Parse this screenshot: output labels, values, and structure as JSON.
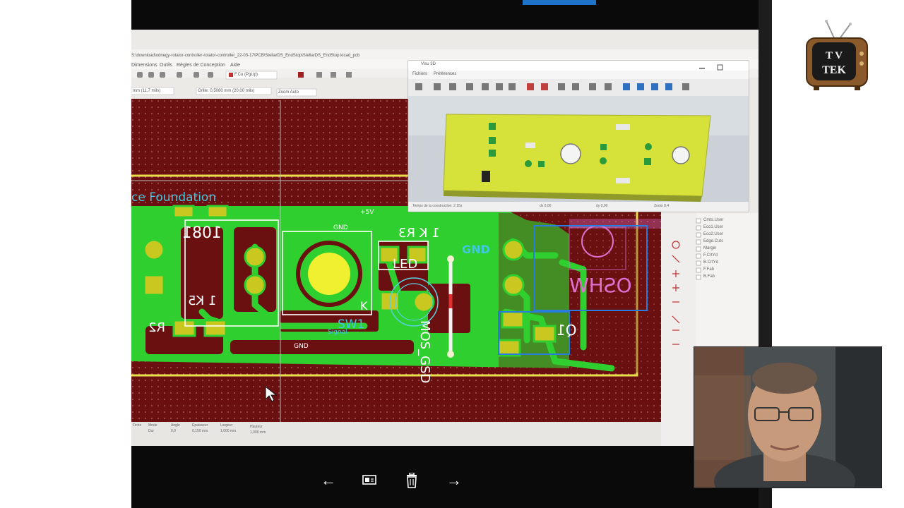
{
  "kicad": {
    "title_path": "S:\\download\\odnegy-rotator-controller-rotator-controller_22-03-17\\PCB\\StellarDS_EndStop\\StellarDS_EndStop.kicad_pcb",
    "menu": [
      "Dimensions",
      "Outils",
      "Règles de Conception",
      "Aide"
    ],
    "layer_select": "F.Cu (PgUp)",
    "track_width": "mm (11,7 mils)",
    "grid": "Grille: 0,5080 mm (20,00 mils)",
    "zoom": "Zoom Auto",
    "status": [
      "Fiche",
      "Mode",
      "Angle",
      "Épaisseur",
      "Largeur",
      "Hauteur"
    ],
    "status_values": [
      "Dur",
      "0,0",
      "0,150 mm",
      "1,000 mm",
      "1,000 mm"
    ]
  },
  "visu3d": {
    "title": "Visu 3D",
    "menu": [
      "Fichiers",
      "Préférences"
    ],
    "status_build": "Temps de la construction: 2 15s",
    "dx": "dx 0,00",
    "dy": "dy 0,00",
    "zoom": "Zoom 8,4"
  },
  "pcb_labels": {
    "foundation": "ce Foundation",
    "plus5v_1": "+5V",
    "gnd_1": "GND",
    "r3": "1 K R3",
    "led": "LED",
    "gnd_big": "GND",
    "r5": "1 K5",
    "r2": "R2",
    "sw1": "SW1",
    "signal": "Signal",
    "gnd_bottom": "GND",
    "oshw": "OSHW",
    "q1": "Q1",
    "mos": "MOS_GSD",
    "k": "K",
    "l801": "1081"
  },
  "layers": [
    "Cmts.User",
    "Eco1.User",
    "Eco2.User",
    "Edge.Cuts",
    "Margin",
    "F.CrtYd",
    "B.CrtYd",
    "F.Fab",
    "B.Fab"
  ],
  "logo": {
    "line1": "T V",
    "line2": "TEK"
  },
  "colors": {
    "board": "#6b1010",
    "copper": "#2fcf2f",
    "pad": "#c8c820",
    "silk": "#ffffff",
    "accent": "#1e73c8"
  }
}
